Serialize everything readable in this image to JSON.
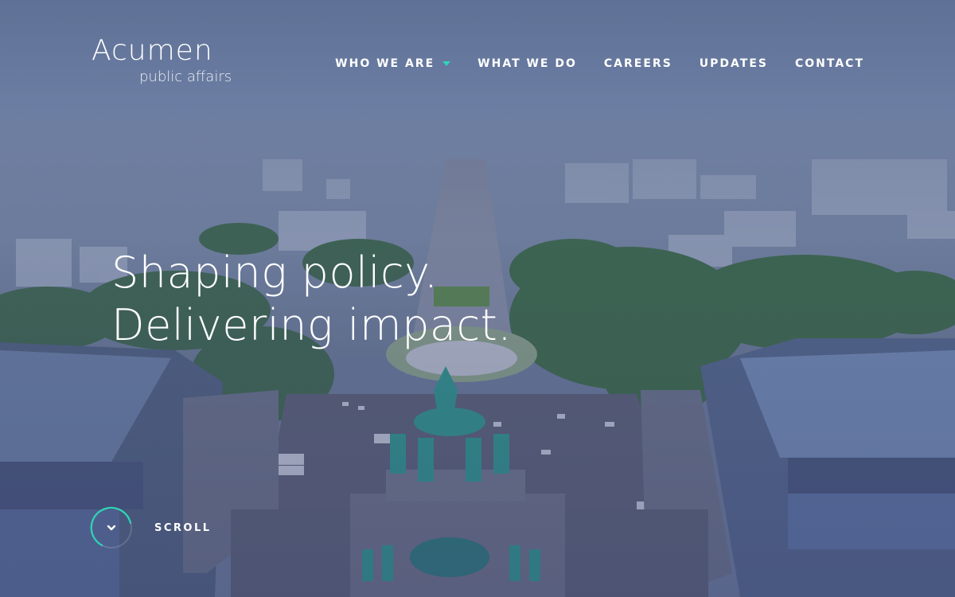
{
  "brand": {
    "name": "Acumen",
    "tagline": "public affairs"
  },
  "nav": {
    "items": [
      {
        "label": "WHO WE ARE",
        "has_dropdown": true
      },
      {
        "label": "WHAT WE DO",
        "has_dropdown": false
      },
      {
        "label": "CAREERS",
        "has_dropdown": false
      },
      {
        "label": "UPDATES",
        "has_dropdown": false
      },
      {
        "label": "CONTACT",
        "has_dropdown": false
      }
    ]
  },
  "hero": {
    "headline_line1": "Shaping policy.",
    "headline_line2": "Delivering impact.",
    "scroll_label": "SCROLL"
  },
  "colors": {
    "accent": "#2fd3b6",
    "text": "#ffffff",
    "overlay": "#46557d"
  },
  "icons": {
    "dropdown": "chevron-down-icon",
    "scroll": "chevron-down-icon"
  }
}
